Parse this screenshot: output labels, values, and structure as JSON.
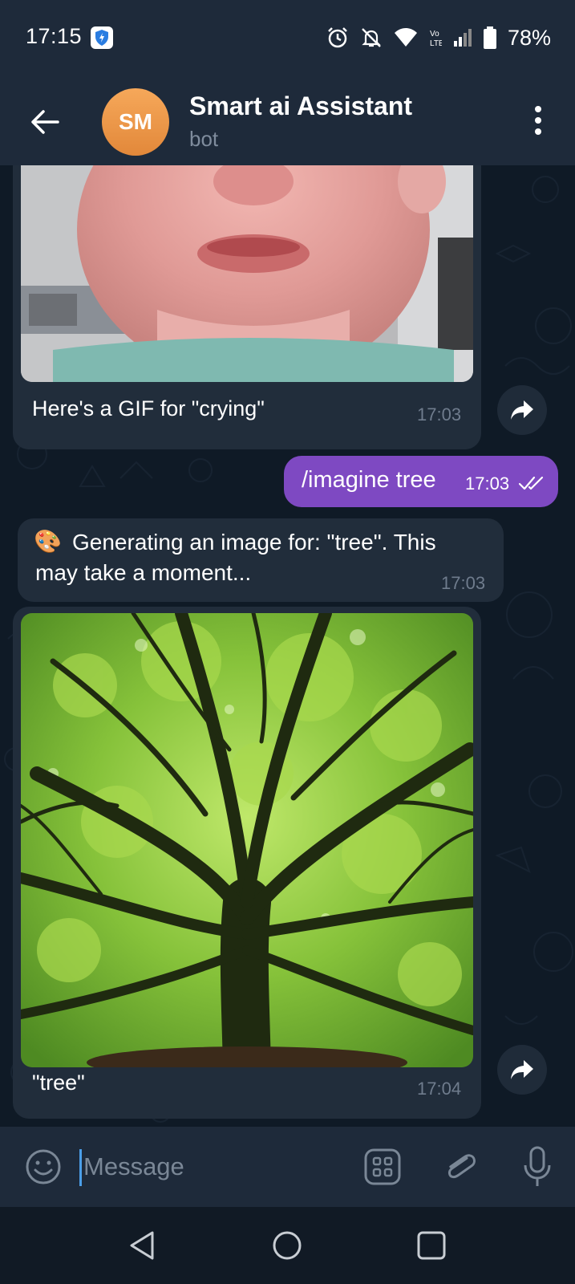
{
  "status_bar": {
    "time": "17:15",
    "battery": "78%",
    "icons": [
      "vpn-shield-icon",
      "alarm-icon",
      "mute-icon",
      "wifi-icon",
      "volte-icon",
      "signal-icon",
      "battery-icon"
    ]
  },
  "header": {
    "avatar_initials": "SM",
    "title": "Smart ai Assistant",
    "subtitle": "bot",
    "accent_color": "#e8913f"
  },
  "messages": [
    {
      "direction": "in",
      "type": "gif",
      "caption": "Here's a GIF for \"crying\"",
      "time": "17:03"
    },
    {
      "direction": "out",
      "type": "text",
      "text": "/imagine tree",
      "time": "17:03",
      "status": "read"
    },
    {
      "direction": "in",
      "type": "text",
      "emoji": "🎨",
      "text_line1": "Generating an image for: \"tree\". This",
      "text_line2": "may take a moment...",
      "time": "17:03"
    },
    {
      "direction": "in",
      "type": "photo",
      "caption": "\"tree\"",
      "time": "17:04"
    }
  ],
  "input": {
    "placeholder": "Message"
  },
  "colors": {
    "outgoing_bubble": "#7e49c2",
    "incoming_bubble": "#212d3b",
    "background": "#0f1a26"
  }
}
